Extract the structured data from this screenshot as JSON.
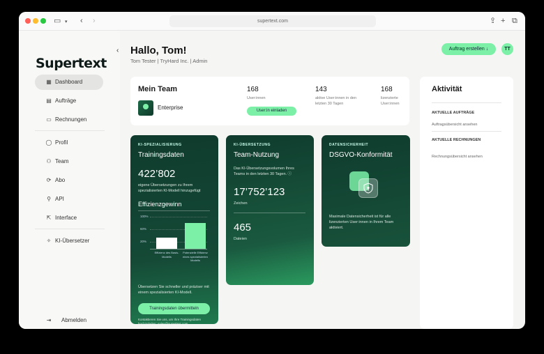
{
  "browser": {
    "url": "supertext.com"
  },
  "app": {
    "logo": "Supertext",
    "collapse": "‹"
  },
  "nav": [
    {
      "label": "Dashboard",
      "icon": "▦"
    },
    {
      "label": "Aufträge",
      "icon": "▤"
    },
    {
      "label": "Rechnungen",
      "icon": "▭"
    },
    {
      "label": "Profil",
      "icon": "◯"
    },
    {
      "label": "Team",
      "icon": "⚇"
    },
    {
      "label": "Abo",
      "icon": "⟳"
    },
    {
      "label": "API",
      "icon": "⚲"
    },
    {
      "label": "Interface",
      "icon": "⇱"
    },
    {
      "label": "KI-Übersetzer",
      "icon": "✧"
    }
  ],
  "logout": {
    "label": "Abmelden",
    "icon": "⇥"
  },
  "header": {
    "greeting": "Hallo, Tom!",
    "subtitle": "Tom Tester | TryHard Inc. | Admin",
    "new_order": "Auftrag erstellen ↓",
    "avatar": "TT"
  },
  "team": {
    "title": "Mein Team",
    "plan": "Enterprise",
    "users": "168",
    "users_label": "User:innen",
    "invite": "User:in einladen",
    "active": "143",
    "active_label": "aktive User:innen in den letzten 30 Tagen",
    "licensed": "168",
    "licensed_label": "lizenzierte User:innen"
  },
  "activity": {
    "title": "Aktivität",
    "orders_head": "AKTUELLE AUFTRÄGE",
    "orders_link": "Auftragsübersicht ansehen",
    "invoices_head": "AKTUELLE RECHNUNGEN",
    "invoices_link": "Rechnungsübersicht ansehen"
  },
  "training": {
    "kicker": "KI-SPEZIALISIERUNG",
    "title": "Trainingsdaten",
    "count": "422’802",
    "count_label": "eigene Übersetzungen zu Ihrem spezialisierten KI-Modell hinzugefügt",
    "chart_title": "Effizienzgewinn",
    "y_ticks": [
      "100%",
      "60%",
      "20%"
    ],
    "bar_base_label": "Effizienz des Basis-Modells",
    "bar_spec_label": "Potenzielle Effizienz eines spezialisierten Modells",
    "bar_base_value": 0.25,
    "bar_spec_value": 0.62,
    "desc": "Übersetzen Sie schneller und präziser mit einem spezialisierten KI-Modell.",
    "button": "Trainingsdaten übermitteln",
    "contact": "Kontaktieren Sie uns, um Ihre Trainingsdaten hochzuladen: sales@supertext.com"
  },
  "usage": {
    "kicker": "KI-ÜBERSETZUNG",
    "title": "Team-Nutzung",
    "desc": "Das KI-Übersetzungsvolumen Ihres Teams in den letzten 30 Tagen. ⓘ",
    "chars": "17’752’123",
    "chars_label": "Zeichen",
    "files": "465",
    "files_label": "Dateien"
  },
  "security": {
    "kicker": "DATENSICHERHEIT",
    "title": "DSGVO-Konformität",
    "desc": "Maximale Datensicherheit ist für alle lizenzierten User:innen in Ihrem Team aktiviert."
  }
}
